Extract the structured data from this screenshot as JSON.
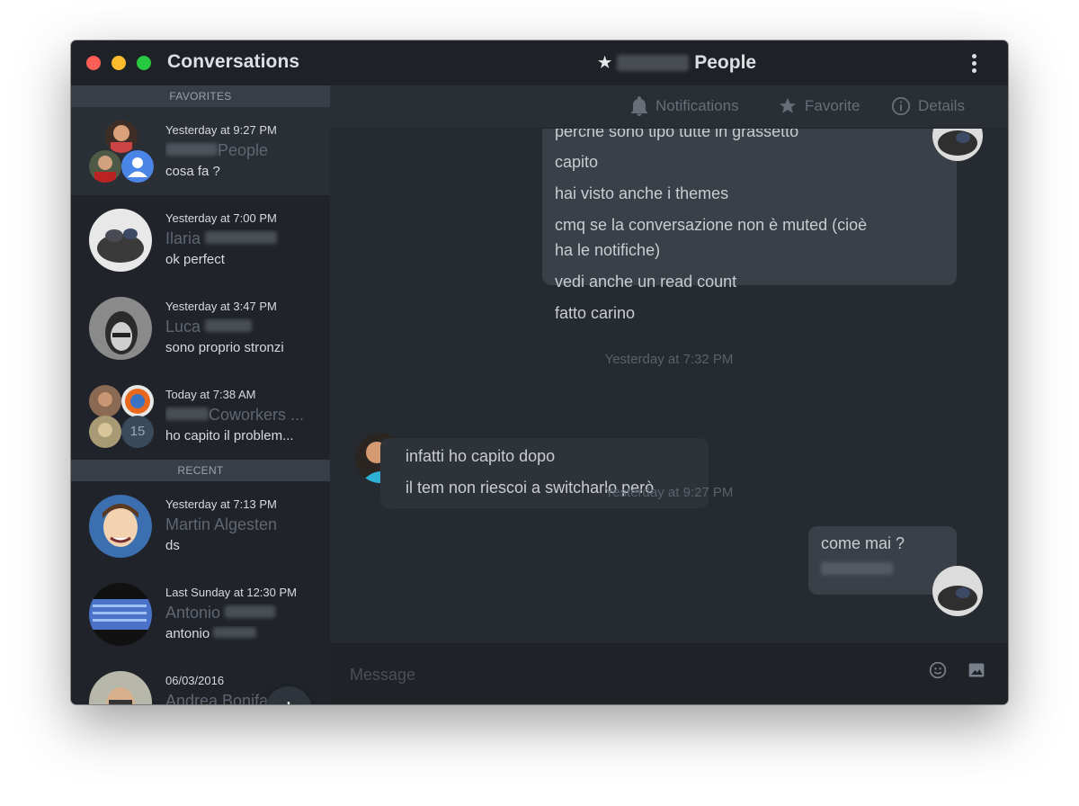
{
  "window": {
    "app_title": "Conversations",
    "conversation_title": "People"
  },
  "toolbar": {
    "notifications_label": "Notifications",
    "favorite_label": "Favorite",
    "details_label": "Details"
  },
  "sidebar": {
    "favorites_header": "FAVORITES",
    "recent_header": "RECENT",
    "favorites": [
      {
        "time": "Yesterday at 9:27 PM",
        "name": "People",
        "preview": "cosa fa ?"
      },
      {
        "time": "Yesterday at 7:00 PM",
        "name": "Ilaria",
        "preview": "ok perfect"
      },
      {
        "time": "Yesterday at 3:47 PM",
        "name": "Luca",
        "preview": "sono proprio stronzi"
      },
      {
        "time": "Today at 7:38 AM",
        "name": "Coworkers ...",
        "preview": "ho capito il problem...",
        "badge": "15"
      }
    ],
    "recent": [
      {
        "time": "Yesterday at 7:13 PM",
        "name": "Martin Algesten",
        "preview": "ds"
      },
      {
        "time": "Last Sunday at 12:30 PM",
        "name": "Antonio",
        "preview": "antonio"
      },
      {
        "time": "06/03/2016",
        "name": "Andrea Bonifacino",
        "preview": ""
      }
    ],
    "fab_label": "+"
  },
  "messages": {
    "block1": [
      "perche sono tipo tutte in grassetto",
      "capito",
      "hai visto anche i themes",
      "cmq se la conversazione non è muted (cioè",
      "ha le notifiche)",
      "vedi anche un read count",
      "fatto carino"
    ],
    "timestamp1": "Yesterday at 7:32 PM",
    "block2": [
      "infatti ho capito dopo",
      "il tem non riescoi a switcharlo però"
    ],
    "timestamp2": "Yesterday at 9:27 PM",
    "block3": [
      "come mai ?"
    ]
  },
  "composer": {
    "placeholder": "Message"
  },
  "colors": {
    "window_bg": "#262b31",
    "sidebar_bg": "#20242a",
    "bubble_out": "#3a4048",
    "bubble_in": "#2e333a",
    "accent_blue": "#4a86e8"
  }
}
